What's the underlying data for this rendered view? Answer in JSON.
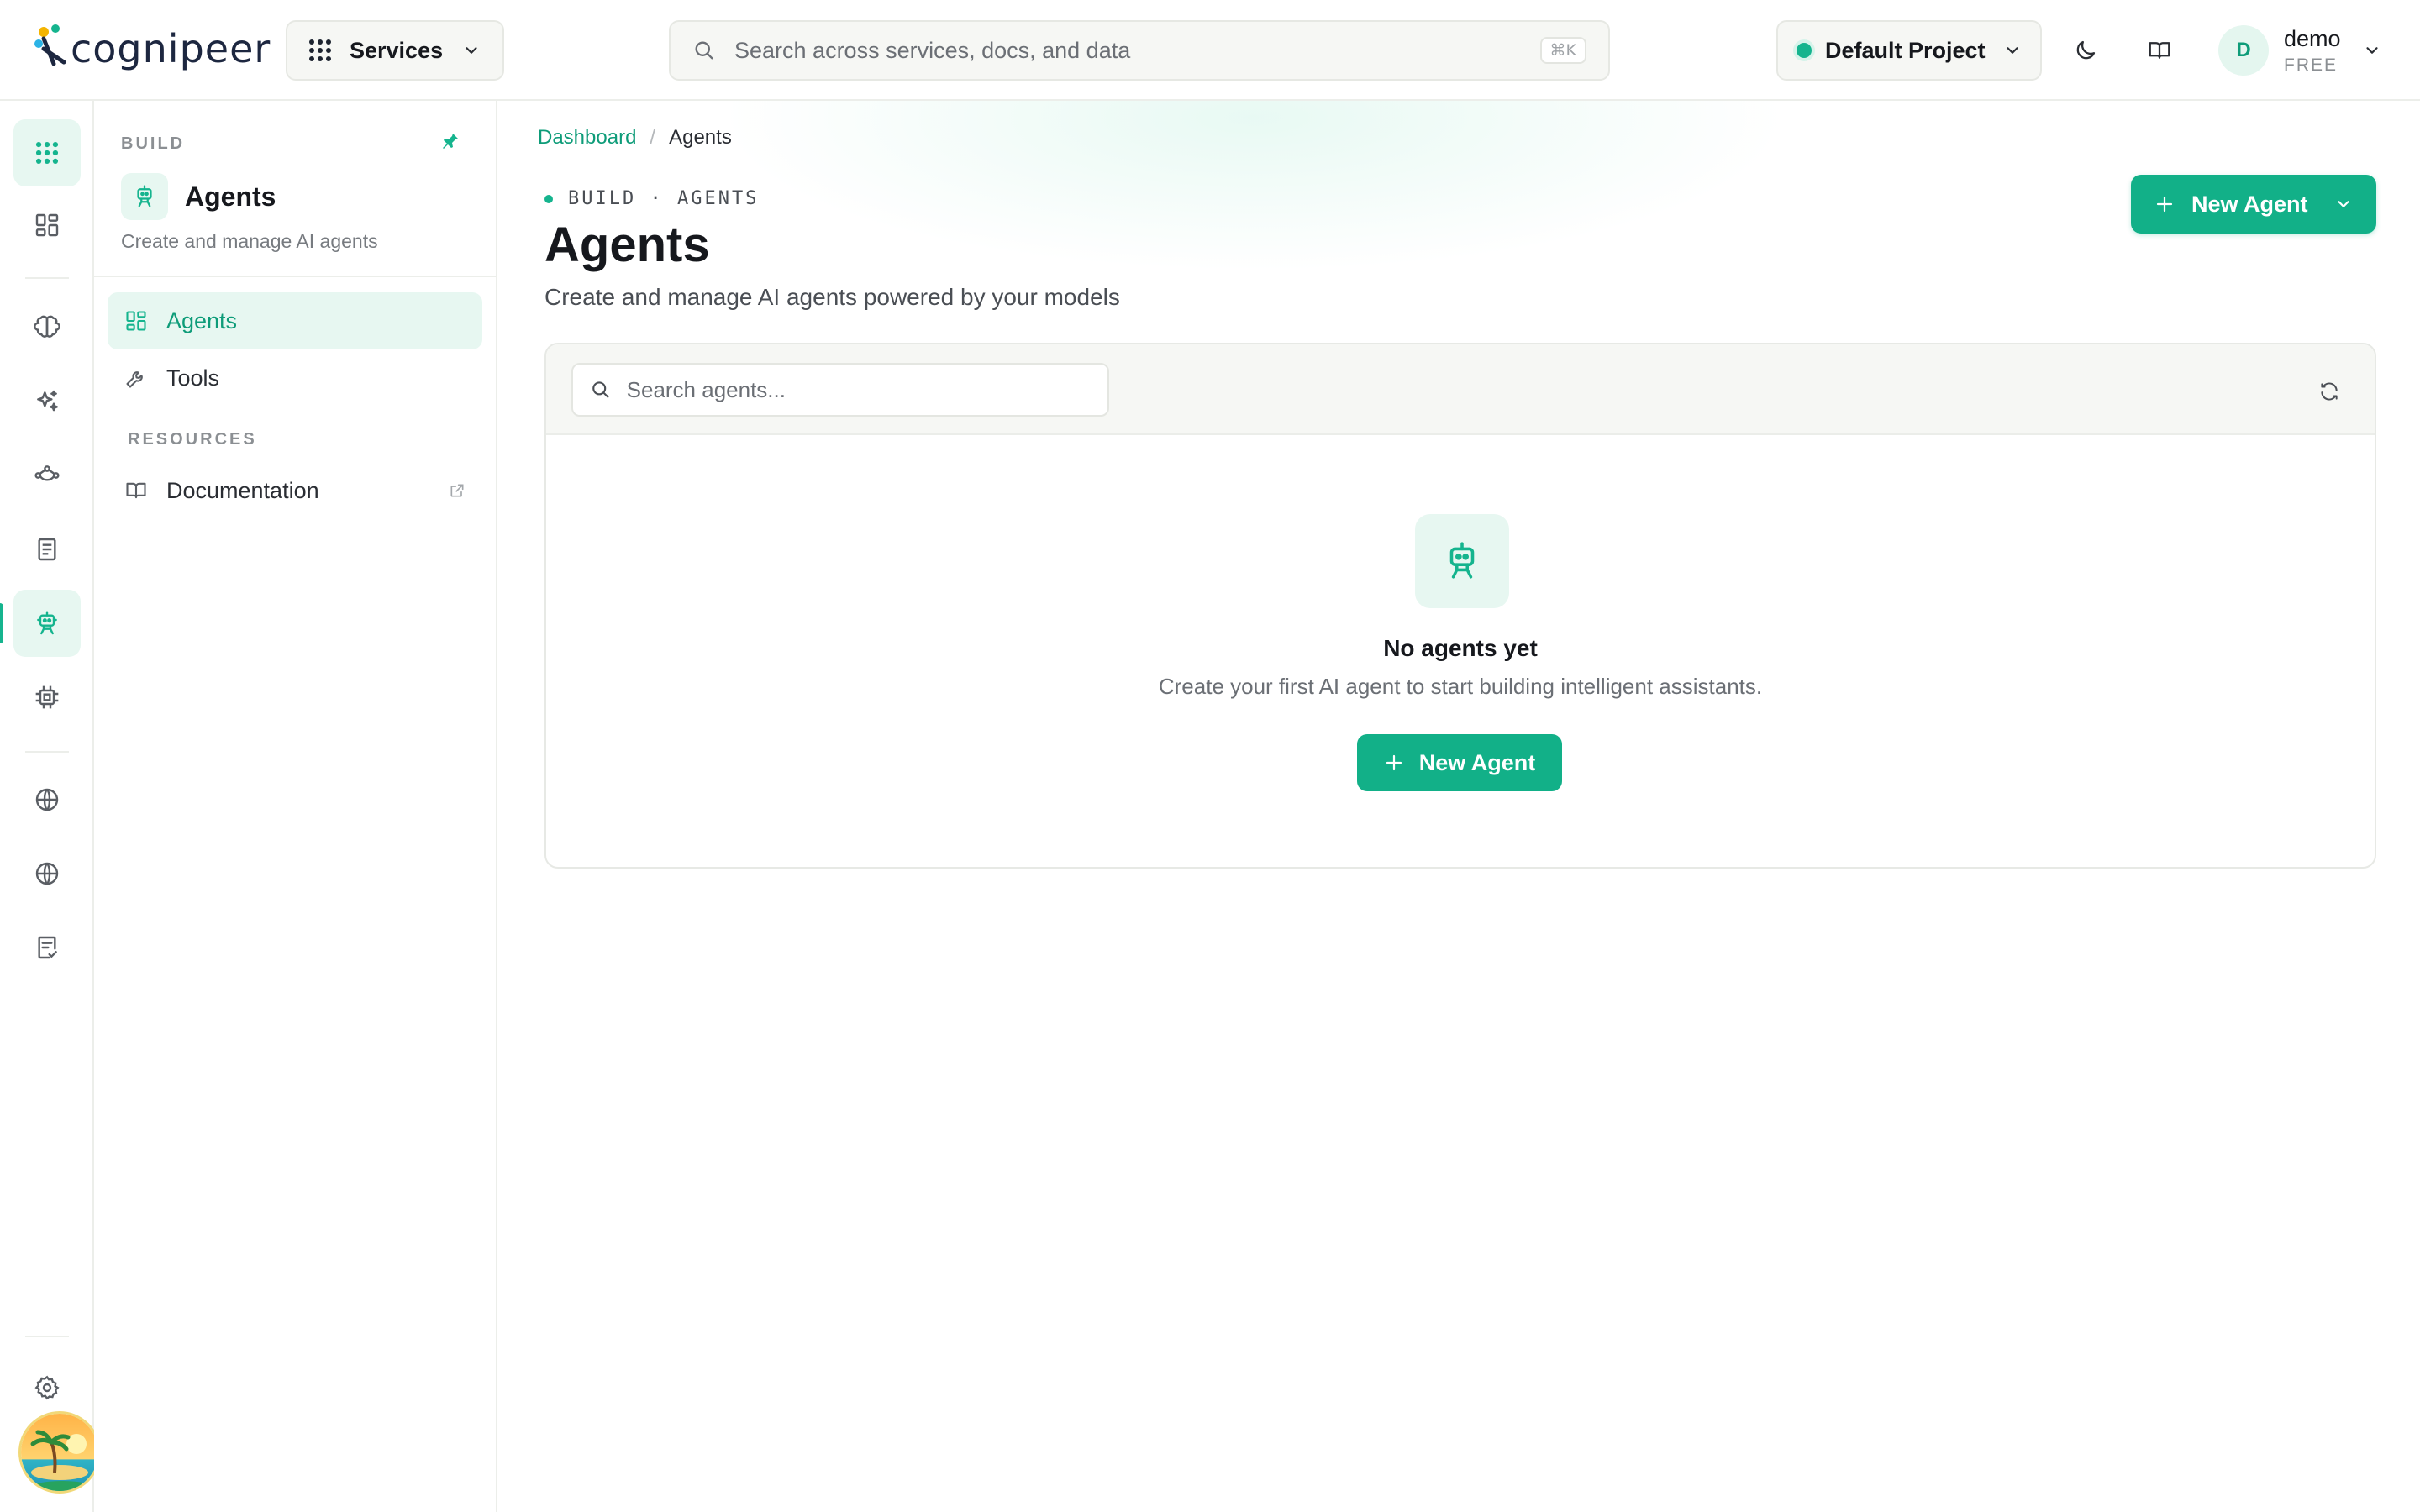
{
  "brand": {
    "name": "cognipeer"
  },
  "topbar": {
    "services_label": "Services",
    "search_placeholder": "Search across services, docs, and data",
    "search_shortcut": "⌘K",
    "project_label": "Default Project",
    "user": {
      "initial": "D",
      "name": "demo",
      "plan": "FREE"
    }
  },
  "sidebar": {
    "section": "BUILD",
    "title": "Agents",
    "subtitle": "Create and manage AI agents",
    "items": [
      {
        "label": "Agents",
        "icon": "grid-icon",
        "active": true
      },
      {
        "label": "Tools",
        "icon": "wrench-icon",
        "active": false
      }
    ],
    "resources_caption": "RESOURCES",
    "resources": [
      {
        "label": "Documentation",
        "icon": "book-icon",
        "external": true
      }
    ]
  },
  "breadcrumb": {
    "root": "Dashboard",
    "separator": "/",
    "current": "Agents"
  },
  "header": {
    "eyebrow": "BUILD · AGENTS",
    "title": "Agents",
    "subtitle": "Create and manage AI agents powered by your models",
    "new_button": "New Agent"
  },
  "panel": {
    "search_placeholder": "Search agents...",
    "empty_title": "No agents yet",
    "empty_subtitle": "Create your first AI agent to start building intelligent assistants.",
    "empty_button": "New Agent"
  },
  "colors": {
    "accent": "#12b088",
    "accent_soft": "#e7f7f1",
    "text": "#16181d"
  }
}
